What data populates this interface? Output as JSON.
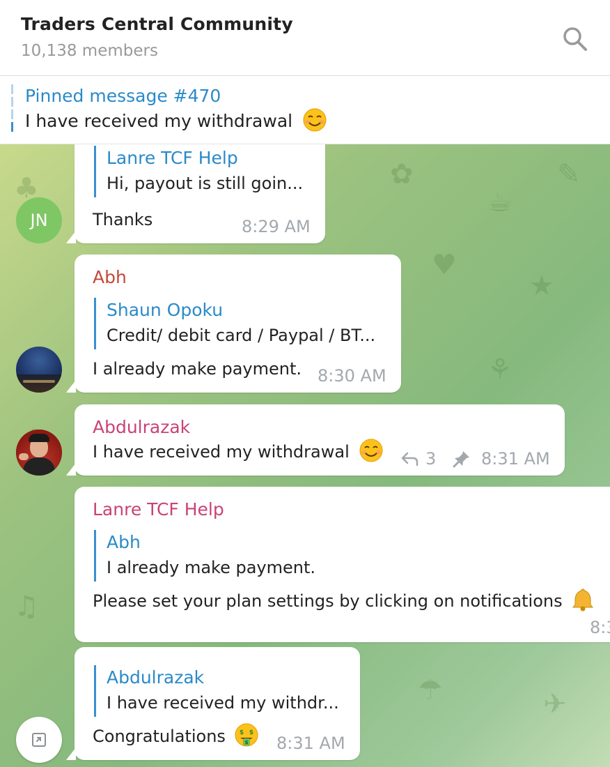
{
  "header": {
    "title": "Traders Central Community",
    "members": "10,138 members",
    "search_icon": "search-icon"
  },
  "pinned": {
    "title": "Pinned message #470",
    "text": "I have received my withdrawal"
  },
  "messages": [
    {
      "avatar_initials": "JN",
      "reply_name": "Lanre TCF Help",
      "reply_text": "Hi,  payout is still goin...",
      "text": "Thanks",
      "time": "8:29 AM"
    },
    {
      "sender": "Abh",
      "sender_color": "#c4473a",
      "reply_name": "Shaun Opoku",
      "reply_text": "Credit/ debit card / Paypal / BT...",
      "text": "I already make payment.",
      "time": "8:30 AM"
    },
    {
      "sender": "Abdulrazak",
      "sender_color": "#c94376",
      "text": "I have received my withdrawal",
      "replies": "3",
      "time": "8:31 AM"
    },
    {
      "sender": "Lanre TCF Help",
      "sender_color": "#c94376",
      "reply_name": "Abh",
      "reply_text": "I already make payment.",
      "text": "Please set your plan settings by clicking on notifications",
      "time": "8:3"
    },
    {
      "reply_name": "Abdulrazak",
      "reply_text": "I have received my withdr...",
      "text": "Congratulations",
      "time": "8:31 AM"
    }
  ],
  "colors": {
    "link_blue": "#2a8ac9",
    "time_gray": "#a3a8ad"
  }
}
